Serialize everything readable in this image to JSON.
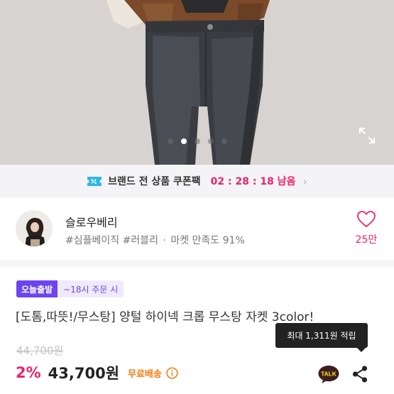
{
  "hero": {
    "slide_count": 5,
    "active_slide": 1,
    "expand_icon": "expand-arrows-icon"
  },
  "coupon": {
    "icon": "coupon-ticket-icon",
    "text": "브랜드 전 상품 쿠폰팩",
    "timer": "02 : 28 : 18 남음",
    "chevron": "›"
  },
  "shop": {
    "name": "슬로우베리",
    "tag1": "#심플베이직",
    "tag2": "#러블리",
    "separator": "·",
    "satisfaction": "마켓 만족도 91%",
    "like_icon": "heart-outline-icon",
    "like_count": "25만"
  },
  "product": {
    "badge_main": "오늘출발",
    "badge_sub": "~18시 주문 시",
    "title": "[도톰,따뜻!/무스탕] 양털 하이넥 크롭 무스탕 자켓 3color!",
    "tooltip": "최대 1,311원 적립",
    "original_price": "44,700원",
    "discount": "2%",
    "price": "43,700원",
    "shipping": "무료배송",
    "talk_label": "TALK"
  },
  "colors": {
    "pink": "#ef2366",
    "purple": "#6d44f0",
    "orange": "#f27a0e"
  }
}
